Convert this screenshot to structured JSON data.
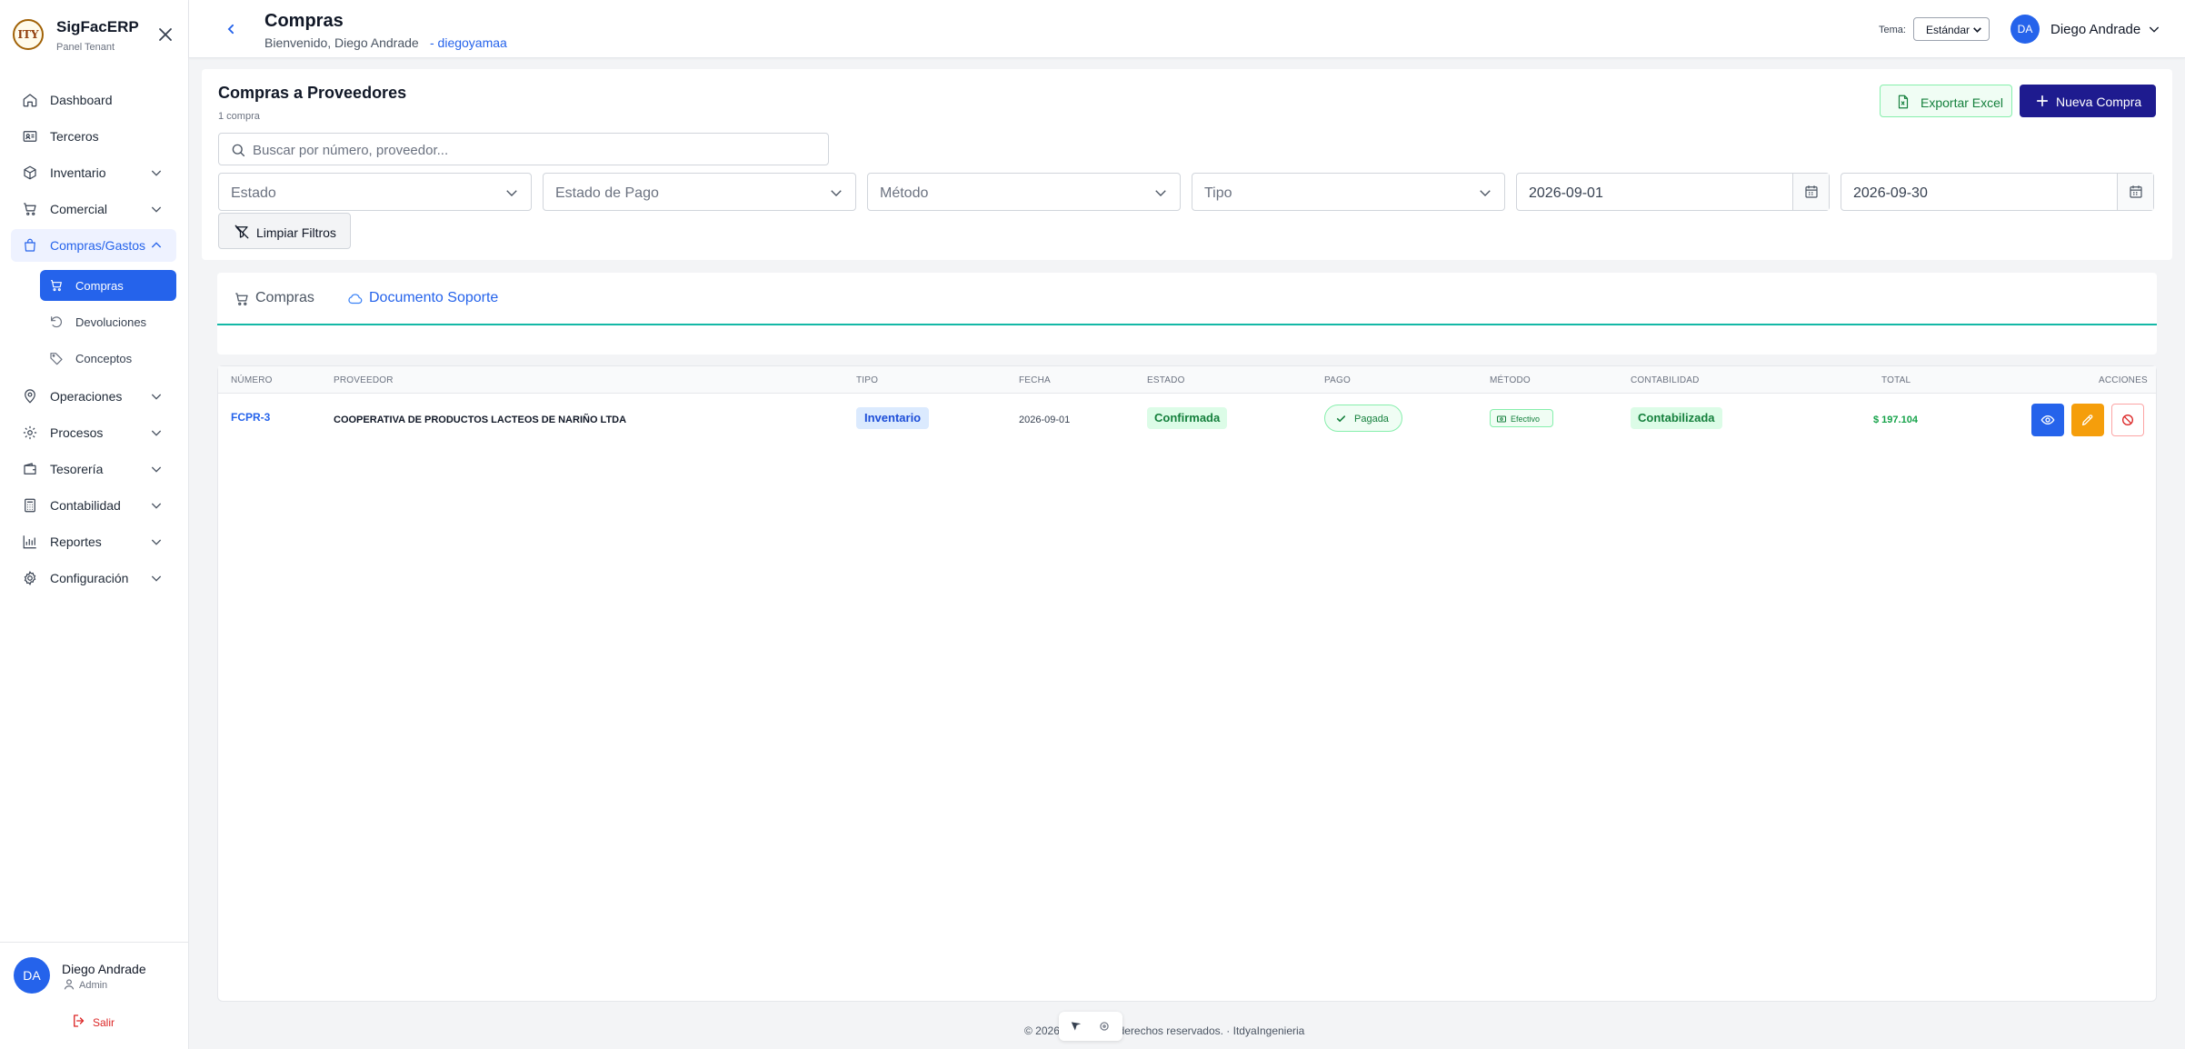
{
  "brand": {
    "title": "SigFacERP",
    "subtitle": "Panel Tenant",
    "logo_text": "ITY"
  },
  "sidebar": {
    "items": [
      {
        "label": "Dashboard",
        "icon": "home-icon"
      },
      {
        "label": "Terceros",
        "icon": "id-card-icon"
      },
      {
        "label": "Inventario",
        "icon": "box-icon"
      },
      {
        "label": "Comercial",
        "icon": "cart-icon"
      },
      {
        "label": "Compras/Gastos",
        "icon": "shopping-bag-icon"
      },
      {
        "label": "Operaciones",
        "icon": "map-pin-icon"
      },
      {
        "label": "Procesos",
        "icon": "gear-icon"
      },
      {
        "label": "Tesorería",
        "icon": "wallet-icon"
      },
      {
        "label": "Contabilidad",
        "icon": "calculator-icon"
      },
      {
        "label": "Reportes",
        "icon": "bar-chart-icon"
      },
      {
        "label": "Configuración",
        "icon": "settings-icon"
      }
    ],
    "subitems": [
      {
        "label": "Compras",
        "icon": "cart-icon"
      },
      {
        "label": "Devoluciones",
        "icon": "undo-icon"
      },
      {
        "label": "Conceptos",
        "icon": "tag-icon"
      }
    ]
  },
  "user": {
    "name": "Diego Andrade",
    "initials": "DA",
    "role": "Admin",
    "logout": "Salir"
  },
  "topbar": {
    "title": "Compras",
    "welcome": "Bienvenido, Diego Andrade",
    "username_link": "- diegoyamaa",
    "theme_label": "Tema:",
    "theme_value": "Estándar"
  },
  "filters": {
    "title": "Compras a Proveedores",
    "count": "1 compra",
    "export_label": "Exportar Excel",
    "new_label": "Nueva Compra",
    "search_placeholder": "Buscar por número, proveedor...",
    "estado": "Estado",
    "estado_pago": "Estado de Pago",
    "metodo": "Método",
    "tipo": "Tipo",
    "fecha_desde": "2026-09-01",
    "fecha_hasta": "2026-09-30",
    "clear_label": "Limpiar Filtros"
  },
  "tabs": [
    {
      "label": "Compras"
    },
    {
      "label": "Documento Soporte"
    }
  ],
  "table": {
    "headers": [
      "NÚMERO",
      "PROVEEDOR",
      "TIPO",
      "FECHA",
      "ESTADO",
      "PAGO",
      "MÉTODO",
      "CONTABILIDAD",
      "TOTAL",
      "ACCIONES"
    ],
    "rows": [
      {
        "numero": "FCPR-3",
        "proveedor": "COOPERATIVA DE PRODUCTOS LACTEOS DE NARIÑO LTDA",
        "tipo": "Inventario",
        "fecha": "2026-09-01",
        "estado": "Confirmada",
        "pago": "Pagada",
        "metodo": "Efectivo",
        "contabilidad": "Contabilizada",
        "total": "$ 197.104"
      }
    ]
  },
  "footer": {
    "text": "© 2026 ... odos los derechos reservados. · ItdyaIngenieria"
  },
  "colors": {
    "primary": "#2563eb",
    "new_button": "#1e1b8f",
    "success": "#15803d",
    "warning": "#f59e0b",
    "danger": "#dc2626",
    "tab_underline": "#14b8a6"
  }
}
